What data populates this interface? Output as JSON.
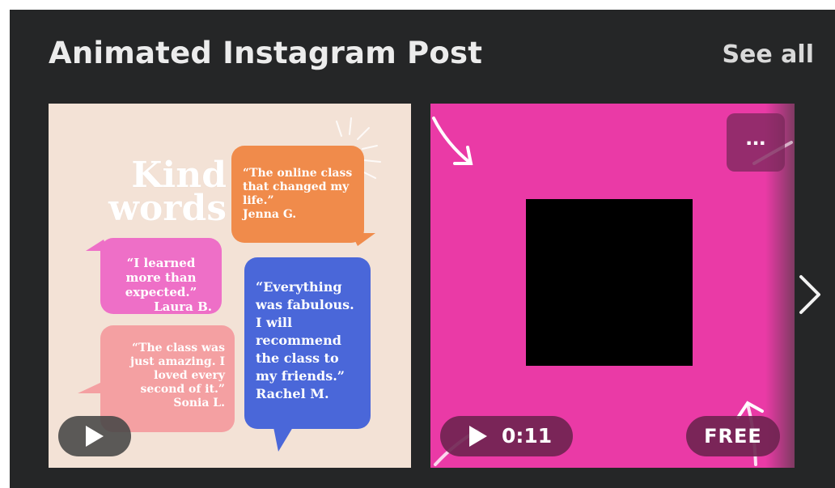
{
  "section": {
    "title": "Animated Instagram Post",
    "see_all": "See all"
  },
  "card1": {
    "headline": "Kind words",
    "quotes": {
      "orange": {
        "text": "“The online class that changed my life.”",
        "author": "Jenna G."
      },
      "pink": {
        "text": "“I learned more than expected.”",
        "author": "Laura B."
      },
      "blue": {
        "text": "“Everything was fabulous. I will recommend the class to my friends.”",
        "author": "Rachel M."
      },
      "salmon": {
        "text": "“The class was just amazing. I loved every second of it.”",
        "author": "Sonia L."
      }
    },
    "colors": {
      "bg": "#f3e2d6",
      "orange": "#f08b4b",
      "pink": "#ee6fc7",
      "blue": "#4a67d9",
      "salmon": "#f4a0a2"
    },
    "play_icon": "play-icon"
  },
  "card2": {
    "duration": "0:11",
    "badge": "FREE",
    "more_label": "...",
    "colors": {
      "bg": "#ea3aa6"
    },
    "icons": [
      "play-icon",
      "more-icon"
    ]
  },
  "nav": {
    "next_icon": "chevron-right-icon"
  },
  "colors": {
    "panel": "#252627"
  }
}
